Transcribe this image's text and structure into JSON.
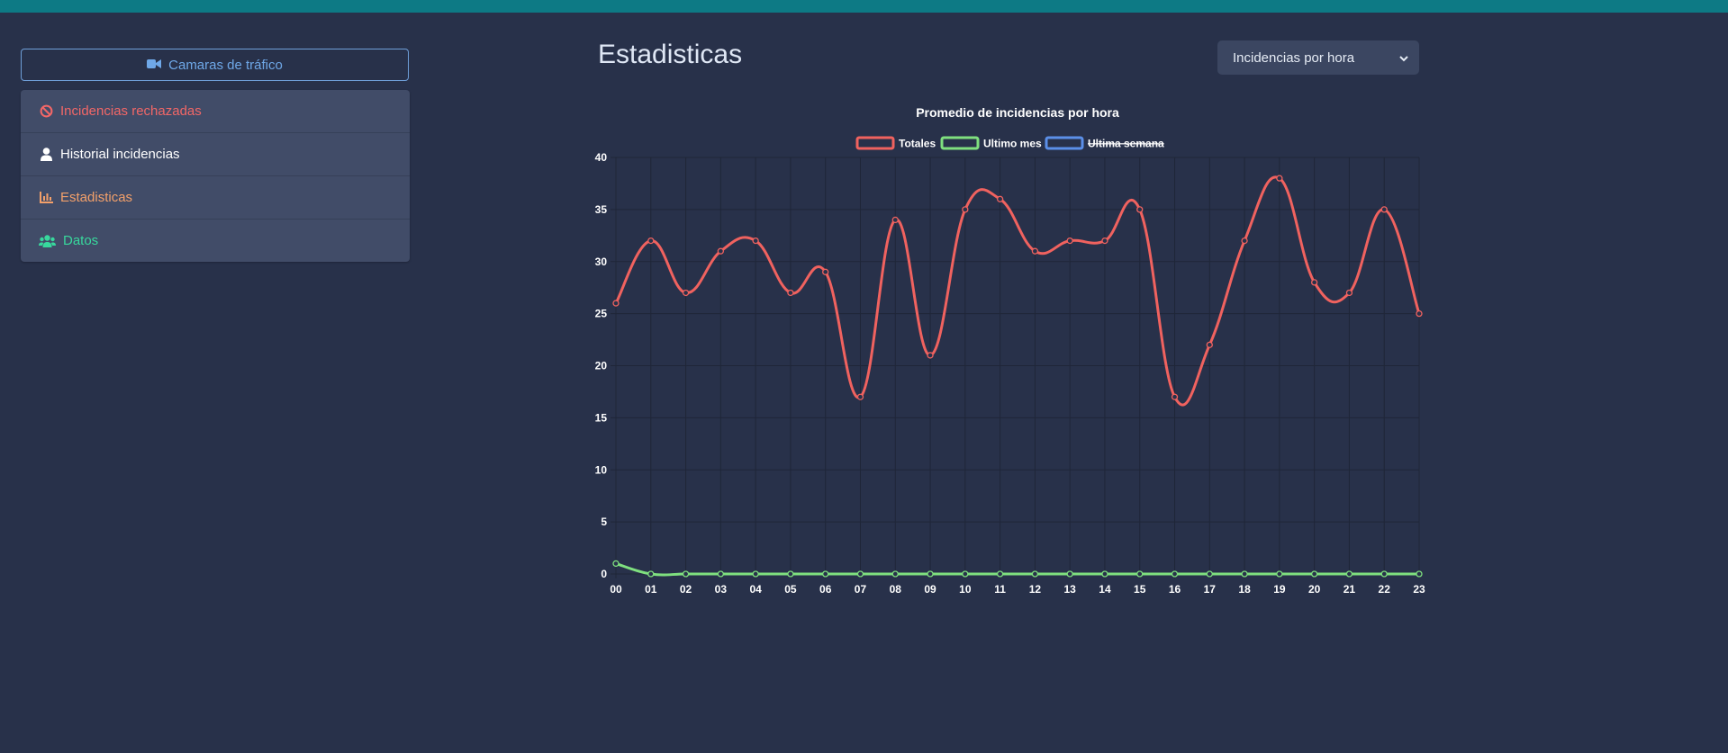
{
  "sidebar": {
    "camera_button": "Camaras de tráfico",
    "items": [
      {
        "label": "Incidencias rechazadas",
        "icon": "ban-icon"
      },
      {
        "label": "Historial incidencias",
        "icon": "user-icon"
      },
      {
        "label": "Estadisticas",
        "icon": "chart-icon"
      },
      {
        "label": "Datos",
        "icon": "users-icon"
      }
    ]
  },
  "header": {
    "title": "Estadisticas",
    "select_value": "Incidencias por hora"
  },
  "colors": {
    "totales": "#f0625f",
    "ultimo_mes": "#7fe07f",
    "ultima_semana": "#5b8fe8",
    "background": "#28314a"
  },
  "chart_data": {
    "type": "line",
    "title": "Promedio de incidencias por hora",
    "x": [
      "00",
      "01",
      "02",
      "03",
      "04",
      "05",
      "06",
      "07",
      "08",
      "09",
      "10",
      "11",
      "12",
      "13",
      "14",
      "15",
      "16",
      "17",
      "18",
      "19",
      "20",
      "21",
      "22",
      "23"
    ],
    "series": [
      {
        "name": "Totales",
        "values": [
          26,
          32,
          27,
          31,
          32,
          27,
          29,
          17,
          34,
          21,
          35,
          36,
          31,
          32,
          32,
          35,
          17,
          22,
          32,
          38,
          28,
          27,
          35,
          25
        ],
        "hidden": false
      },
      {
        "name": "Ultimo mes",
        "values": [
          1,
          0,
          0,
          0,
          0,
          0,
          0,
          0,
          0,
          0,
          0,
          0,
          0,
          0,
          0,
          0,
          0,
          0,
          0,
          0,
          0,
          0,
          0,
          0
        ],
        "hidden": false
      },
      {
        "name": "Ultima semana",
        "values": [],
        "hidden": true
      }
    ],
    "ylim": [
      0,
      40
    ],
    "yticks": [
      0,
      5,
      10,
      15,
      20,
      25,
      30,
      35,
      40
    ],
    "legend": "top",
    "grid": true
  }
}
